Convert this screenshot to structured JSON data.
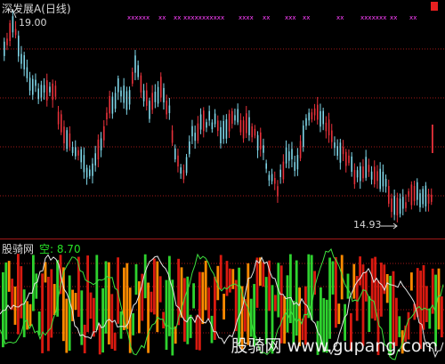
{
  "main_chart": {
    "title": "深发展A(日线)",
    "high_label": "19.00",
    "low_label": "14.93",
    "high": 19.0,
    "low": 14.93
  },
  "indicator": {
    "name": "股骑网",
    "value_text": "空: 8.70"
  },
  "watermark": "股骑网 www.gupang.com",
  "colors": {
    "up": "#e8313a",
    "down": "#7fd6e8",
    "grid": "#a01818",
    "marker": "#ff40ff",
    "bar_red": "#d81a10",
    "bar_green": "#2ed22e",
    "bar_orange": "#ff8a00",
    "line_green": "#3ee23e",
    "line_white": "#e6e6e6",
    "text": "#d8d8d8"
  }
}
